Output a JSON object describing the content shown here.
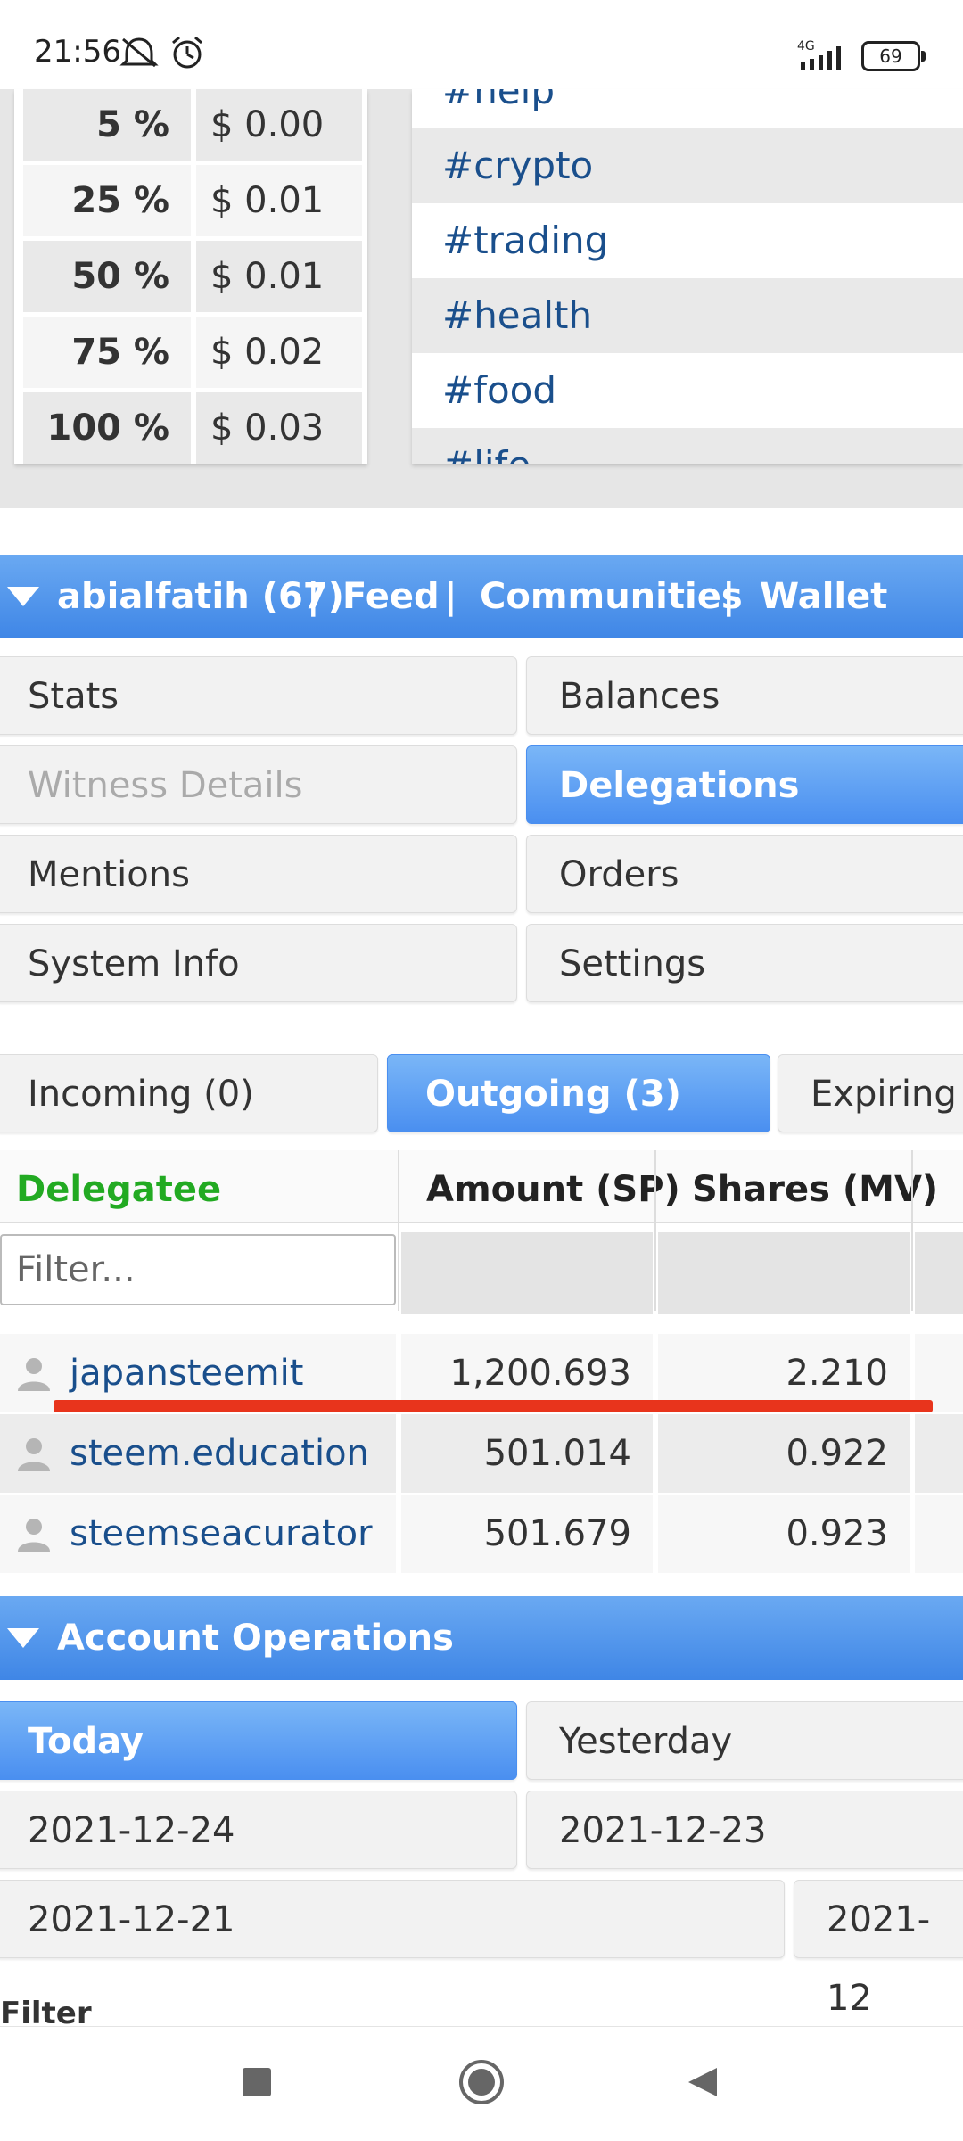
{
  "status_bar": {
    "time": "21:56",
    "network": "4G",
    "battery": "69",
    "icons": [
      "notifications-off-icon",
      "alarm-icon",
      "signal-icon",
      "battery-icon"
    ]
  },
  "percent_table": [
    {
      "pct": "5 %",
      "value": "$ 0.00"
    },
    {
      "pct": "25 %",
      "value": "$ 0.01"
    },
    {
      "pct": "50 %",
      "value": "$ 0.01"
    },
    {
      "pct": "75 %",
      "value": "$ 0.02"
    },
    {
      "pct": "100 %",
      "value": "$ 0.03"
    }
  ],
  "tags": [
    "#help",
    "#crypto",
    "#trading",
    "#health",
    "#food",
    "#life"
  ],
  "account_bar": {
    "user": "abialfatih (67)",
    "sep": "|",
    "feed": "Feed",
    "communities": "Communities",
    "wallet": "Wallet"
  },
  "nav": {
    "stats": "Stats",
    "balances": "Balances",
    "witness_details": "Witness Details",
    "delegations": "Delegations",
    "mentions": "Mentions",
    "orders": "Orders",
    "system_info": "System Info",
    "settings": "Settings"
  },
  "delegation_tabs": {
    "incoming": "Incoming (0)",
    "outgoing": "Outgoing (3)",
    "expiring": "Expiring"
  },
  "table": {
    "headers": [
      "Delegatee",
      "Amount (SP)",
      "Shares (MV)"
    ],
    "filter_placeholder": "Filter...",
    "rows": [
      {
        "delegatee": "japansteemit",
        "amount": "1,200.693",
        "shares": "2.210"
      },
      {
        "delegatee": "steem.education",
        "amount": "501.014",
        "shares": "0.922"
      },
      {
        "delegatee": "steemseacurator",
        "amount": "501.679",
        "shares": "0.923"
      }
    ]
  },
  "account_operations": {
    "title": "Account Operations",
    "today": "Today",
    "yesterday": "Yesterday",
    "dates": [
      "2021-12-24",
      "2021-12-23",
      "2021-12-21",
      "2021-12"
    ],
    "filter_label": "Filter"
  },
  "colors": {
    "accent_blue": "#4a8ff0",
    "link_blue": "#1a4f8c",
    "delegatee_green": "#22aa22",
    "highlight_red": "#e8341c"
  }
}
